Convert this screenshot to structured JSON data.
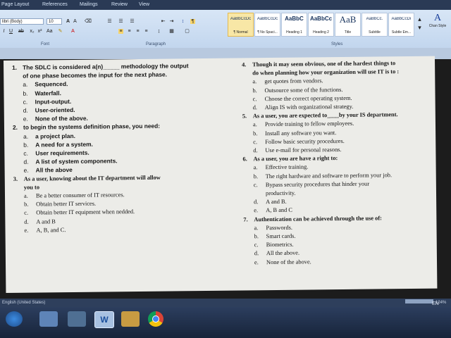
{
  "menu": {
    "tabs": [
      "Page Layout",
      "References",
      "Mailings",
      "Review",
      "View"
    ]
  },
  "ribbon": {
    "font_name": "libri (Body)",
    "font_size": "10",
    "groups": {
      "font": "Font",
      "paragraph": "Paragraph",
      "styles": "Styles"
    },
    "styles": [
      {
        "preview": "AaBbCcDc",
        "name": "¶ Normal",
        "selected": true,
        "kind": "small"
      },
      {
        "preview": "AaBbCcDc",
        "name": "¶ No Spaci...",
        "kind": "small"
      },
      {
        "preview": "AaBbC",
        "name": "Heading 1",
        "kind": "mid"
      },
      {
        "preview": "AaBbCc",
        "name": "Heading 2",
        "kind": "mid"
      },
      {
        "preview": "AaB",
        "name": "Title",
        "kind": "big"
      },
      {
        "preview": "AaBbCc.",
        "name": "Subtitle",
        "kind": "small"
      },
      {
        "preview": "AaBbCcDı",
        "name": "Subtle Em...",
        "kind": "small"
      }
    ],
    "change_styles": "Chan Style"
  },
  "document": {
    "left_column": [
      {
        "type": "q",
        "num": "1.",
        "text": "The SDLC is considered a(n)_____ methodology the output"
      },
      {
        "type": "cont",
        "text": "of one phase becomes the input for the next phase.",
        "bold": true
      },
      {
        "type": "opt",
        "letter": "a.",
        "text": "Sequenced."
      },
      {
        "type": "opt",
        "letter": "b.",
        "text": "Waterfall."
      },
      {
        "type": "opt",
        "letter": "c.",
        "text": "Input-output."
      },
      {
        "type": "opt",
        "letter": "d.",
        "text": "User-oriented."
      },
      {
        "type": "opt",
        "letter": "e.",
        "text": "None of the above."
      },
      {
        "type": "q",
        "num": "2.",
        "text": "to begin the systems definition phase, you need:"
      },
      {
        "type": "opt",
        "letter": "a.",
        "text": "a project plan."
      },
      {
        "type": "opt",
        "letter": "b.",
        "text": "A need for a system."
      },
      {
        "type": "opt",
        "letter": "c.",
        "text": "User requirements."
      },
      {
        "type": "opt",
        "letter": "d.",
        "text": "A list of system components."
      },
      {
        "type": "opt",
        "letter": "e.",
        "text": "All the above"
      },
      {
        "type": "q",
        "num": "3.",
        "text": "As a user, knowing about the IT department  will allow",
        "serif": true
      },
      {
        "type": "cont",
        "text": "you to",
        "bold": true,
        "serif": true
      },
      {
        "type": "opt",
        "letter": "a.",
        "text": "Be a better consumer of IT resources.",
        "serif": true
      },
      {
        "type": "opt",
        "letter": "b.",
        "text": "Obtain better IT services.",
        "serif": true
      },
      {
        "type": "opt",
        "letter": "c.",
        "text": "Obtain better IT equipment when nedded.",
        "serif": true
      },
      {
        "type": "opt",
        "letter": "d.",
        "text": "A and B",
        "serif": true
      },
      {
        "type": "opt",
        "letter": "e.",
        "text": "A, B, and C.",
        "serif": true
      }
    ],
    "right_column": [
      {
        "type": "q",
        "num": "4.",
        "text": "Though it may seem obvious, one of the hardest things to",
        "serif": true
      },
      {
        "type": "cont",
        "text": "do when planning how your organization will use IT is to :",
        "bold": true,
        "serif": true
      },
      {
        "type": "opt",
        "letter": "a.",
        "text": "get quotes from vendors.",
        "serif": true
      },
      {
        "type": "opt",
        "letter": "b.",
        "text": "Outsource some of the functions.",
        "serif": true
      },
      {
        "type": "opt",
        "letter": "c.",
        "text": "Choose the correct operating system.",
        "serif": true
      },
      {
        "type": "opt",
        "letter": "d.",
        "text": "Align IS with organizational strategy.",
        "serif": true
      },
      {
        "type": "q",
        "num": "5.",
        "text": "As a user, you are expected to____by your IS department.",
        "serif": true
      },
      {
        "type": "opt",
        "letter": "a.",
        "text": "Provide training to fellow employees.",
        "serif": true
      },
      {
        "type": "opt",
        "letter": "b.",
        "text": "Install any software you want.",
        "serif": true
      },
      {
        "type": "opt",
        "letter": "c.",
        "text": "Follow basic security procedures.",
        "serif": true
      },
      {
        "type": "opt",
        "letter": "d.",
        "text": "Use e-mail for personal reasons.",
        "serif": true
      },
      {
        "type": "q",
        "num": "6.",
        "text": "As a user, you are have a right to:",
        "serif": true
      },
      {
        "type": "opt",
        "letter": "a.",
        "text": "Effective training.",
        "serif": true
      },
      {
        "type": "opt",
        "letter": "b.",
        "text": "The right hardware and software to perform your job.",
        "serif": true
      },
      {
        "type": "opt",
        "letter": "c.",
        "text": "Bypass security procedures that hinder your",
        "serif": true
      },
      {
        "type": "cont2",
        "text": "productivity.",
        "serif": true
      },
      {
        "type": "opt",
        "letter": "d.",
        "text": "A and B.",
        "serif": true
      },
      {
        "type": "opt",
        "letter": "e.",
        "text": "A, B and C",
        "serif": true
      },
      {
        "type": "q",
        "num": "7.",
        "text": "Authentication can be achieved through the use of:",
        "serif": true
      },
      {
        "type": "opt",
        "letter": "a.",
        "text": "Passwords.",
        "serif": true
      },
      {
        "type": "opt",
        "letter": "b.",
        "text": "Smart cards.",
        "serif": true
      },
      {
        "type": "opt",
        "letter": "c.",
        "text": "Biometrics.",
        "serif": true
      },
      {
        "type": "opt",
        "letter": "d.",
        "text": "All the above.",
        "serif": true
      },
      {
        "type": "opt",
        "letter": "e.",
        "text": "None of the above.",
        "serif": true
      }
    ]
  },
  "status": {
    "language": "English (United States)",
    "zoom": "124%",
    "input_lang": "EN"
  },
  "taskbar": {
    "icons": [
      "start-orb-icon",
      "media-player-icon",
      "windows-explorer-icon",
      "word-icon",
      "folder-icon",
      "chrome-icon"
    ]
  }
}
